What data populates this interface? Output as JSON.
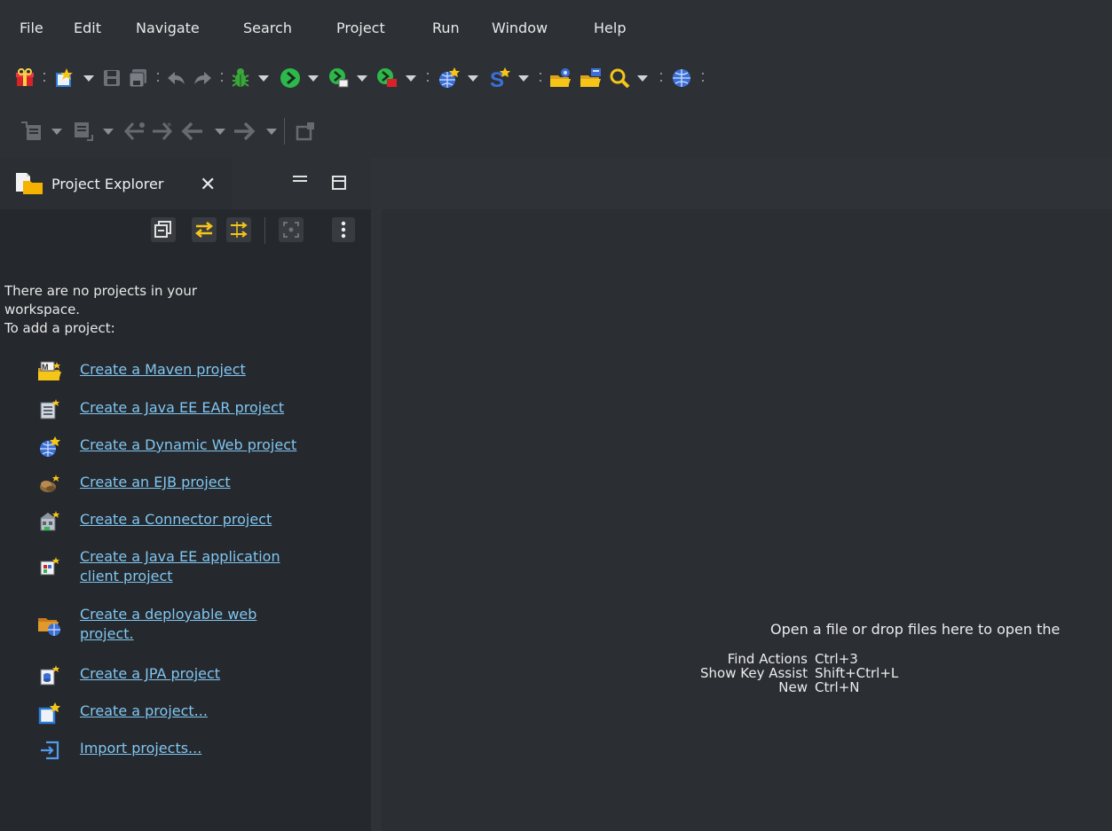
{
  "menu": [
    "File",
    "Edit",
    "Navigate",
    "Search",
    "Project",
    "Run",
    "Window",
    "Help"
  ],
  "toolbar_icons": [
    "gift-icon",
    "new-file-icon",
    "save-icon",
    "save-all-icon",
    "undo-icon",
    "redo-icon",
    "debug-bug-icon",
    "run-icon",
    "run-coverage-icon",
    "external-tools-icon",
    "new-dynamic-web-icon",
    "new-spring-icon",
    "open-type-icon",
    "open-resource-icon",
    "search-icon",
    "web-browser-icon"
  ],
  "project_explorer": {
    "tab_title": "Project Explorer",
    "empty_message": [
      "There are no projects in your",
      "workspace.",
      "To add a project:"
    ],
    "links": [
      {
        "label": "Create a Maven project",
        "icon": "maven-project-icon"
      },
      {
        "label": "Create a Java EE EAR project",
        "icon": "ear-project-icon"
      },
      {
        "label": "Create a Dynamic Web project",
        "icon": "dynamic-web-project-icon"
      },
      {
        "label": "Create an EJB project",
        "icon": "ejb-project-icon"
      },
      {
        "label": "Create a Connector project",
        "icon": "connector-project-icon"
      },
      {
        "label": "Create a Java EE application client project",
        "label_lines": [
          "Create a Java EE application ",
          "client project"
        ],
        "icon": "app-client-project-icon"
      },
      {
        "label": "Create a deployable web project.",
        "label_lines": [
          "Create a deployable web ",
          "project."
        ],
        "icon": "deployable-web-project-icon"
      },
      {
        "label": "Create a JPA project",
        "icon": "jpa-project-icon"
      },
      {
        "label": "Create a project...",
        "icon": "new-project-icon"
      },
      {
        "label": "Import projects...",
        "icon": "import-projects-icon"
      }
    ]
  },
  "editor": {
    "hint": "Open a file or drop files here to open the",
    "shortcuts": [
      {
        "name": "Find Actions",
        "keys": "Ctrl+3"
      },
      {
        "name": "Show Key Assist",
        "keys": "Shift+Ctrl+L"
      },
      {
        "name": "New",
        "keys": "Ctrl+N"
      }
    ]
  },
  "colors": {
    "background": "#2f3338",
    "panel": "#25282c",
    "link": "#80c6f2",
    "accent_yellow": "#f5c518",
    "accent_green": "#2db84b",
    "accent_red": "#d8222a"
  }
}
